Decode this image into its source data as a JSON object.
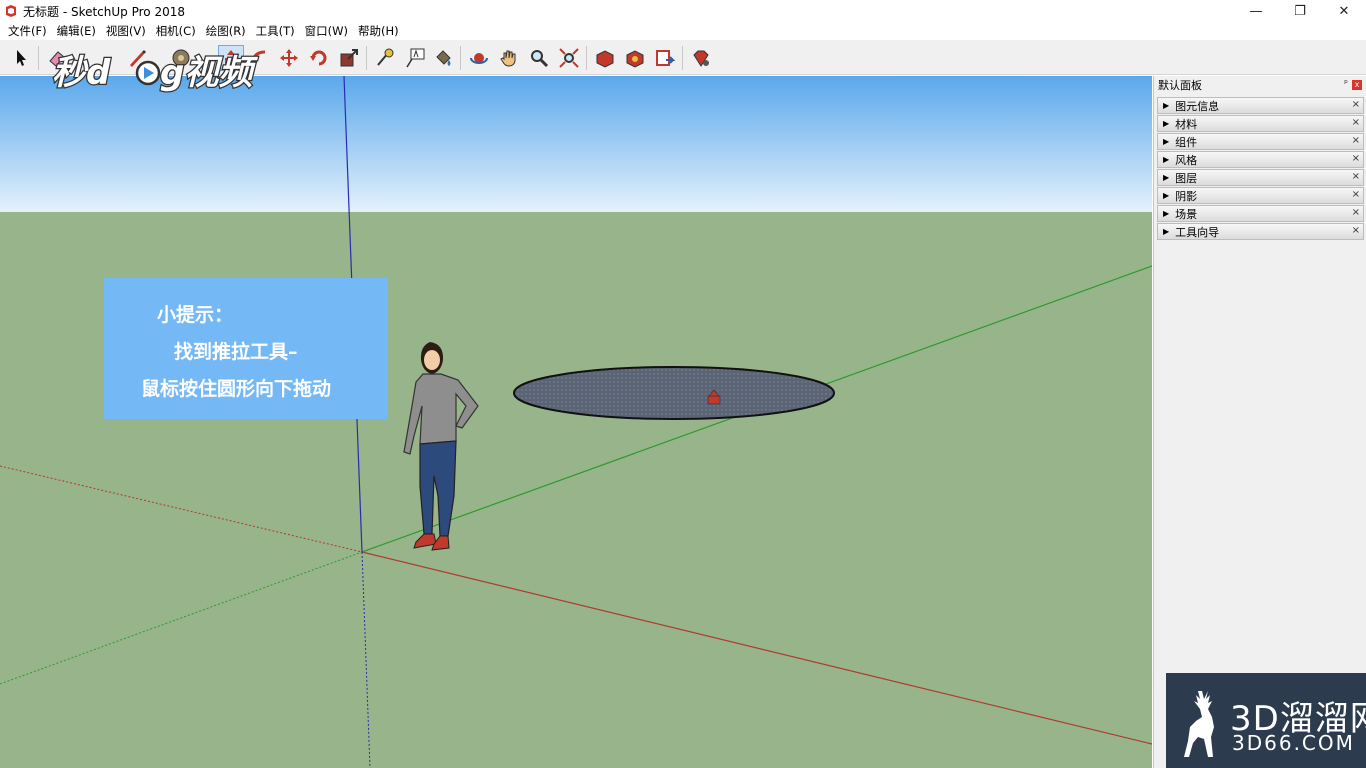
{
  "window": {
    "title": "无标题 - SketchUp Pro 2018",
    "minimize": "—",
    "restore": "❐",
    "close": "✕"
  },
  "menu": [
    "文件(F)",
    "编辑(E)",
    "视图(V)",
    "相机(C)",
    "绘图(R)",
    "工具(T)",
    "窗口(W)",
    "帮助(H)"
  ],
  "logo_text": "秒懂视频",
  "tip": {
    "line1": "小提示：",
    "line2": "找到推拉工具–",
    "line3": "鼠标按住圆形向下拖动"
  },
  "panel": {
    "title": "默认面板",
    "pin": "ᵖ",
    "close": "x",
    "trays": [
      "图元信息",
      "材料",
      "组件",
      "风格",
      "图层",
      "阴影",
      "场景",
      "工具向导"
    ],
    "tray_close": "×"
  },
  "watermark": {
    "big": "3D溜溜网",
    "small": "3D66.COM"
  },
  "colors": {
    "sky_top": "#5aa8ec",
    "sky_bottom": "#e4f1fc",
    "ground": "#97b48b",
    "tip_bg": "#74b8f6",
    "red_axis": "#b03a2e",
    "green_axis": "#2f9a2f",
    "blue_axis": "#2b2bb0",
    "circle_face": "#5a6475",
    "watermark_bg": "#2c3c4e"
  }
}
